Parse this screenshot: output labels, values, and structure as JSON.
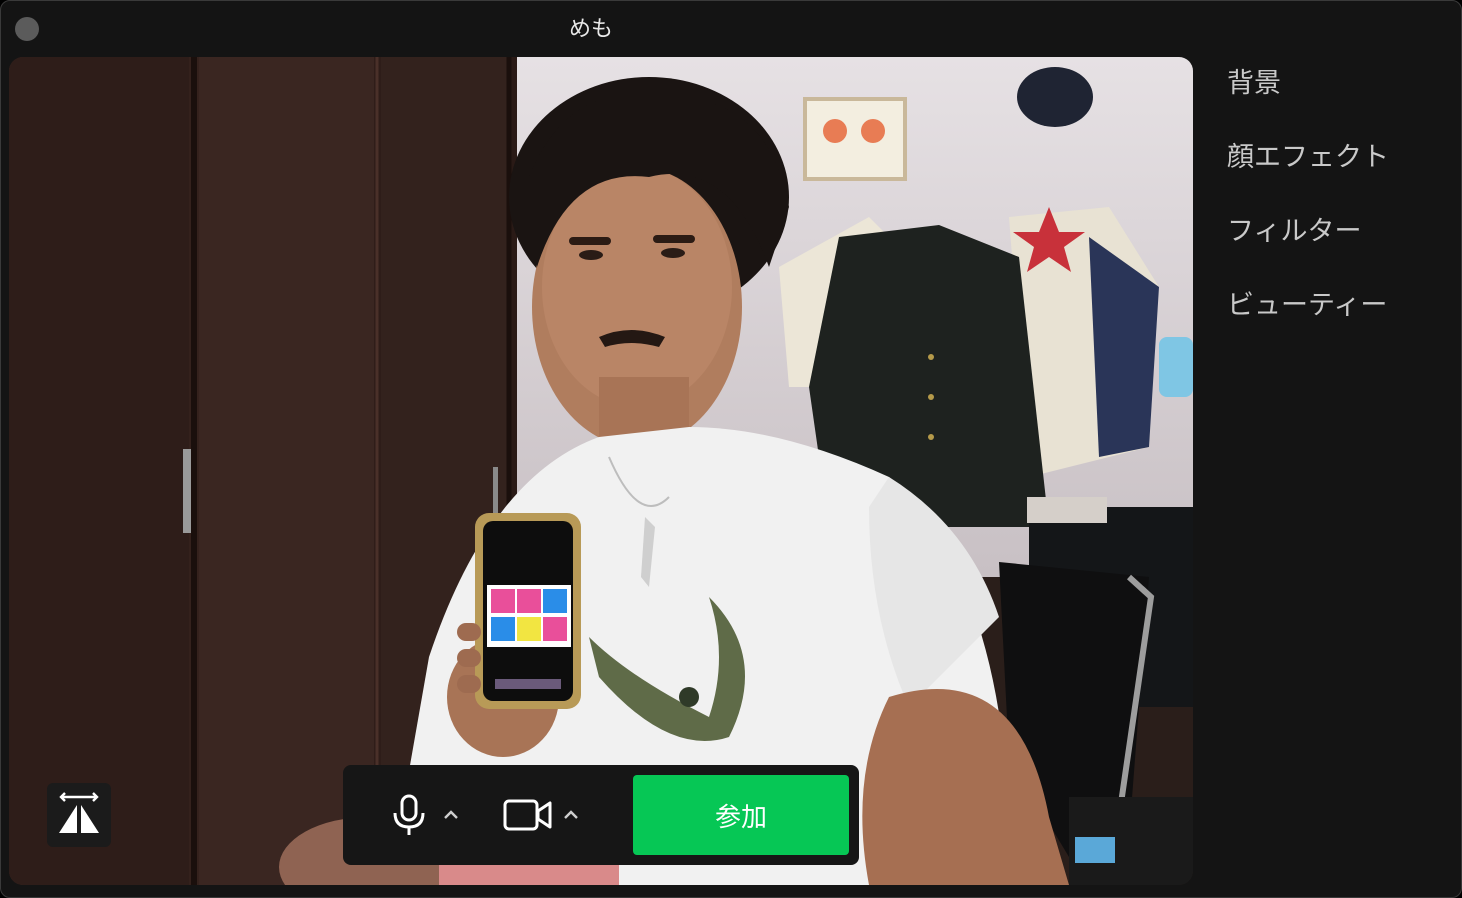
{
  "window": {
    "title": "めも"
  },
  "side_menu": {
    "items": [
      {
        "label": "背景"
      },
      {
        "label": "顔エフェクト"
      },
      {
        "label": "フィルター"
      },
      {
        "label": "ビューティー"
      }
    ]
  },
  "controls": {
    "mic_icon": "microphone-icon",
    "camera_icon": "video-camera-icon",
    "mirror_icon": "mirror-flip-icon",
    "join_label": "参加"
  },
  "colors": {
    "join_button": "#06c755",
    "window_bg": "#141414",
    "menu_text": "#c9c9c9"
  }
}
